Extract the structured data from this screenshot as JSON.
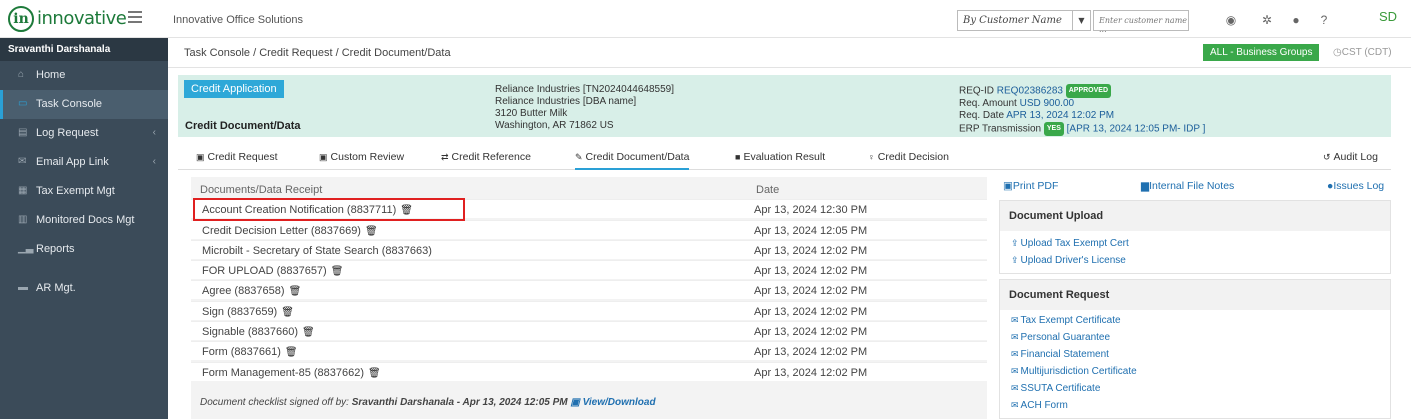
{
  "topbar": {
    "logo_mark": "in",
    "logo_text": "innovative",
    "company": "Innovative Office Solutions",
    "search_select": "By Customer Name",
    "search_placeholder": "Enter customer name ...",
    "user_initials": "SD"
  },
  "sidebar": {
    "user": "Sravanthi Darshanala",
    "items": [
      {
        "label": "Home",
        "icon": "home-icon"
      },
      {
        "label": "Task Console",
        "icon": "monitor-icon"
      },
      {
        "label": "Log Request",
        "icon": "list-icon"
      },
      {
        "label": "Email App Link",
        "icon": "envelope-icon"
      },
      {
        "label": "Tax Exempt Mgt",
        "icon": "form-icon"
      },
      {
        "label": "Monitored Docs Mgt",
        "icon": "table-icon"
      },
      {
        "label": "Reports",
        "icon": "bar-chart-icon"
      },
      {
        "label": "AR Mgt.",
        "icon": "card-icon"
      }
    ]
  },
  "breadcrumb": "Task Console  /  Credit Request  /  Credit Document/Data",
  "business_group": "ALL - Business Groups",
  "timezone": "CST (CDT)",
  "header": {
    "badge": "Credit Application",
    "section_title": "Credit Document/Data",
    "addr_line1": "Reliance Industries [TN2024044648559]",
    "addr_line2": "Reliance Industries [DBA name]",
    "addr_line3": "3120 Butter Milk",
    "addr_line4": "Washington, AR 71862 US",
    "req_id_label": "REQ-ID",
    "req_id": "REQ02386283",
    "req_status": "APPROVED",
    "req_amount_label": "Req. Amount",
    "req_amount": "USD 900.00",
    "req_date_label": "Req. Date",
    "req_date": "APR 13, 2024 12:02 PM",
    "erp_label": "ERP Transmission",
    "erp_status": "YES",
    "erp_value": "[APR 13, 2024 12:05 PM- IDP ]"
  },
  "tabs": [
    {
      "label": "Credit Request",
      "glyph": "▣"
    },
    {
      "label": "Custom Review",
      "glyph": "▣"
    },
    {
      "label": "Credit Reference",
      "glyph": "⇄"
    },
    {
      "label": "Credit Document/Data",
      "glyph": "✎"
    },
    {
      "label": "Evaluation Result",
      "glyph": "■"
    },
    {
      "label": "Credit Decision",
      "glyph": "♀"
    }
  ],
  "audit_log": "Audit Log",
  "documents": {
    "col_doc": "Documents/Data Receipt",
    "col_date": "Date",
    "rows": [
      {
        "name": "Account Creation Notification (8837711)",
        "date": "Apr 13, 2024 12:30 PM",
        "trash": true
      },
      {
        "name": "Credit Decision Letter (8837669)",
        "date": "Apr 13, 2024 12:05 PM",
        "trash": true
      },
      {
        "name": "Microbilt - Secretary of State Search (8837663)",
        "date": "Apr 13, 2024 12:02 PM",
        "trash": false
      },
      {
        "name": "FOR UPLOAD (8837657)",
        "date": "Apr 13, 2024 12:02 PM",
        "trash": true
      },
      {
        "name": "Agree (8837658)",
        "date": "Apr 13, 2024 12:02 PM",
        "trash": true
      },
      {
        "name": "Sign (8837659)",
        "date": "Apr 13, 2024 12:02 PM",
        "trash": true
      },
      {
        "name": "Signable (8837660)",
        "date": "Apr 13, 2024 12:02 PM",
        "trash": true
      },
      {
        "name": "Form (8837661)",
        "date": "Apr 13, 2024 12:02 PM",
        "trash": true
      },
      {
        "name": "Form Management-85 (8837662)",
        "date": "Apr 13, 2024 12:02 PM",
        "trash": true
      }
    ],
    "signoff_prefix": "Document checklist signed off by:",
    "signoff_by": "Sravanthi Darshanala - Apr 13, 2024 12:05 PM",
    "signoff_link": "View/Download"
  },
  "right": {
    "print_pdf": "Print PDF",
    "internal_notes": "Internal File Notes",
    "issues_log": "Issues Log",
    "upload_title": "Document Upload",
    "upload_links": [
      "Upload Tax Exempt Cert",
      "Upload Driver's License"
    ],
    "request_title": "Document Request",
    "request_links": [
      "Tax Exempt Certificate",
      "Personal Guarantee",
      "Financial Statement",
      "Multijurisdiction Certificate",
      "SSUTA Certificate",
      "ACH Form"
    ]
  },
  "colors": {
    "brand": "#1d7a3a",
    "sidebar": "#3b4b59",
    "accent": "#2aa0d6",
    "highlight": "#e02020"
  }
}
